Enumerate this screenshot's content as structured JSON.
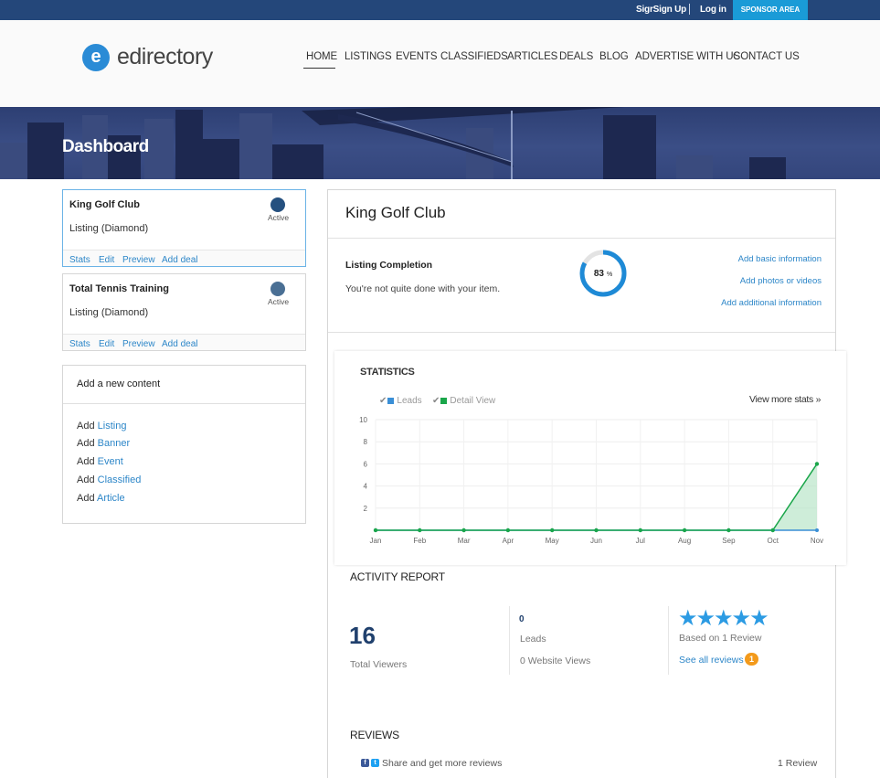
{
  "topbar": {
    "signup": "SigrSign Up",
    "login": "Log in",
    "sponsor": "SPONSOR AREA"
  },
  "logo": {
    "letter": "e",
    "text": "edirectory"
  },
  "nav": [
    "HOME",
    "LISTINGS",
    "EVENTS",
    "CLASSIFIEDS",
    "ARTICLES",
    "DEALS",
    "BLOG",
    "ADVERTISE WITH US",
    "CONTACT US"
  ],
  "hero": {
    "title": "Dashboard"
  },
  "items": [
    {
      "name": "King Golf Club",
      "type": "Listing (Diamond)",
      "status": "Active",
      "links": [
        "Stats",
        "Edit",
        "Preview",
        "Add deal"
      ]
    },
    {
      "name": "Total Tennis Training",
      "type": "Listing (Diamond)",
      "status": "Active",
      "links": [
        "Stats",
        "Edit",
        "Preview",
        "Add deal"
      ]
    }
  ],
  "add_content": {
    "heading": "Add a new content",
    "prefix": "Add",
    "items": [
      "Listing",
      "Banner",
      "Event",
      "Classified",
      "Article"
    ]
  },
  "main": {
    "title": "King Golf Club",
    "completion": {
      "label": "Listing Completion",
      "message": "You're not quite done with your item.",
      "percent": 83,
      "percent_value": "83",
      "percent_sign": "%",
      "links": [
        "Add basic information",
        "Add photos or videos",
        "Add additional information"
      ]
    }
  },
  "statistics": {
    "title": "STATISTICS",
    "legend": [
      "Leads",
      "Detail View"
    ],
    "view_more": "View more stats »",
    "colors": {
      "leads": "#3a8fd6",
      "detail_view": "#1aa64a"
    }
  },
  "chart_data": {
    "type": "line",
    "categories": [
      "Jan",
      "Feb",
      "Mar",
      "Apr",
      "May",
      "Jun",
      "Jul",
      "Aug",
      "Sep",
      "Oct",
      "Nov"
    ],
    "ylim": [
      0,
      10
    ],
    "yticks": [
      "10",
      "8",
      "6",
      "4",
      "2"
    ],
    "series": [
      {
        "name": "Leads",
        "values": [
          0,
          0,
          0,
          0,
          0,
          0,
          0,
          0,
          0,
          0,
          0
        ]
      },
      {
        "name": "Detail View",
        "values": [
          0,
          0,
          0,
          0,
          0,
          0,
          0,
          0,
          0,
          0,
          6
        ]
      }
    ]
  },
  "activity": {
    "title": "ACTIVITY REPORT",
    "total_viewers_value": "16",
    "total_viewers_label": "Total Viewers",
    "leads_value": "0",
    "leads_label": "Leads",
    "website_views": "0 Website Views",
    "rating": {
      "stars": 5,
      "stars_glyph": "★★★★★",
      "based_on": "Based on 1 Review",
      "see_all": "See all reviews",
      "count": "1"
    }
  },
  "reviews": {
    "title": "REVIEWS",
    "share_text": "Share and get more reviews",
    "count_label": "1 Review",
    "facebook": "f",
    "twitter": "t"
  }
}
